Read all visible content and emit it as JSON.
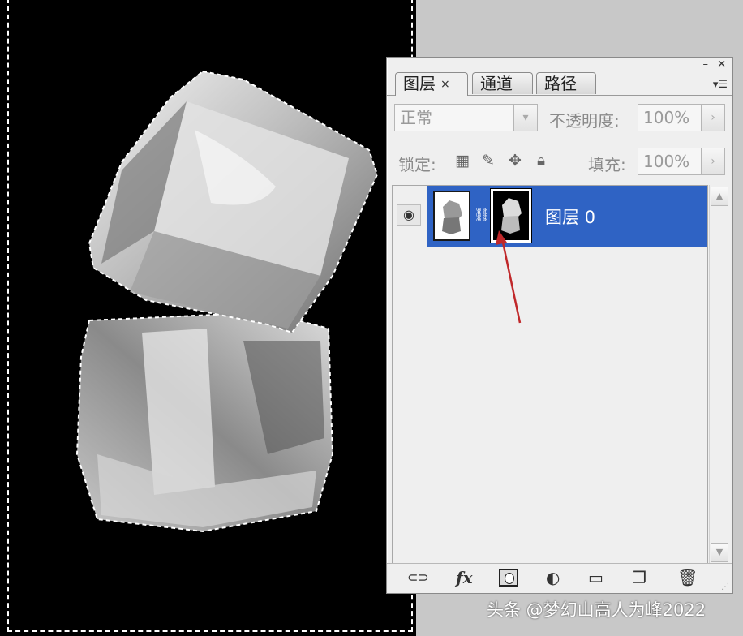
{
  "panel": {
    "controls": {
      "minimize_icon": "minimize-icon",
      "close_icon": "close-icon"
    },
    "tabs": [
      {
        "label": "图层",
        "active": true,
        "close": "×"
      },
      {
        "label": "通道",
        "active": false
      },
      {
        "label": "路径",
        "active": false
      }
    ],
    "menu_icon": "▾☰",
    "blend_mode": "正常",
    "opacity_label": "不透明度:",
    "opacity_value": "100%",
    "lock_label": "锁定:",
    "lock_icons": [
      "lock-transparent-icon",
      "lock-image-icon",
      "lock-position-icon",
      "lock-all-icon"
    ],
    "fill_label": "填充:",
    "fill_value": "100%",
    "layers": [
      {
        "name": "图层 0",
        "visible": true,
        "selected": true,
        "has_mask": true
      }
    ],
    "footer_icons": [
      "link-layers-icon",
      "fx-icon",
      "add-mask-icon",
      "adjustment-layer-icon",
      "group-icon",
      "new-layer-icon",
      "trash-icon"
    ],
    "fx_label": "fx"
  },
  "colors": {
    "selection": "#2f63c4",
    "canvas": "#000000",
    "panel_bg": "#efefef",
    "annotation_arrow": "#c0282a"
  },
  "watermark": "头条 @梦幻山高人为峰2022"
}
